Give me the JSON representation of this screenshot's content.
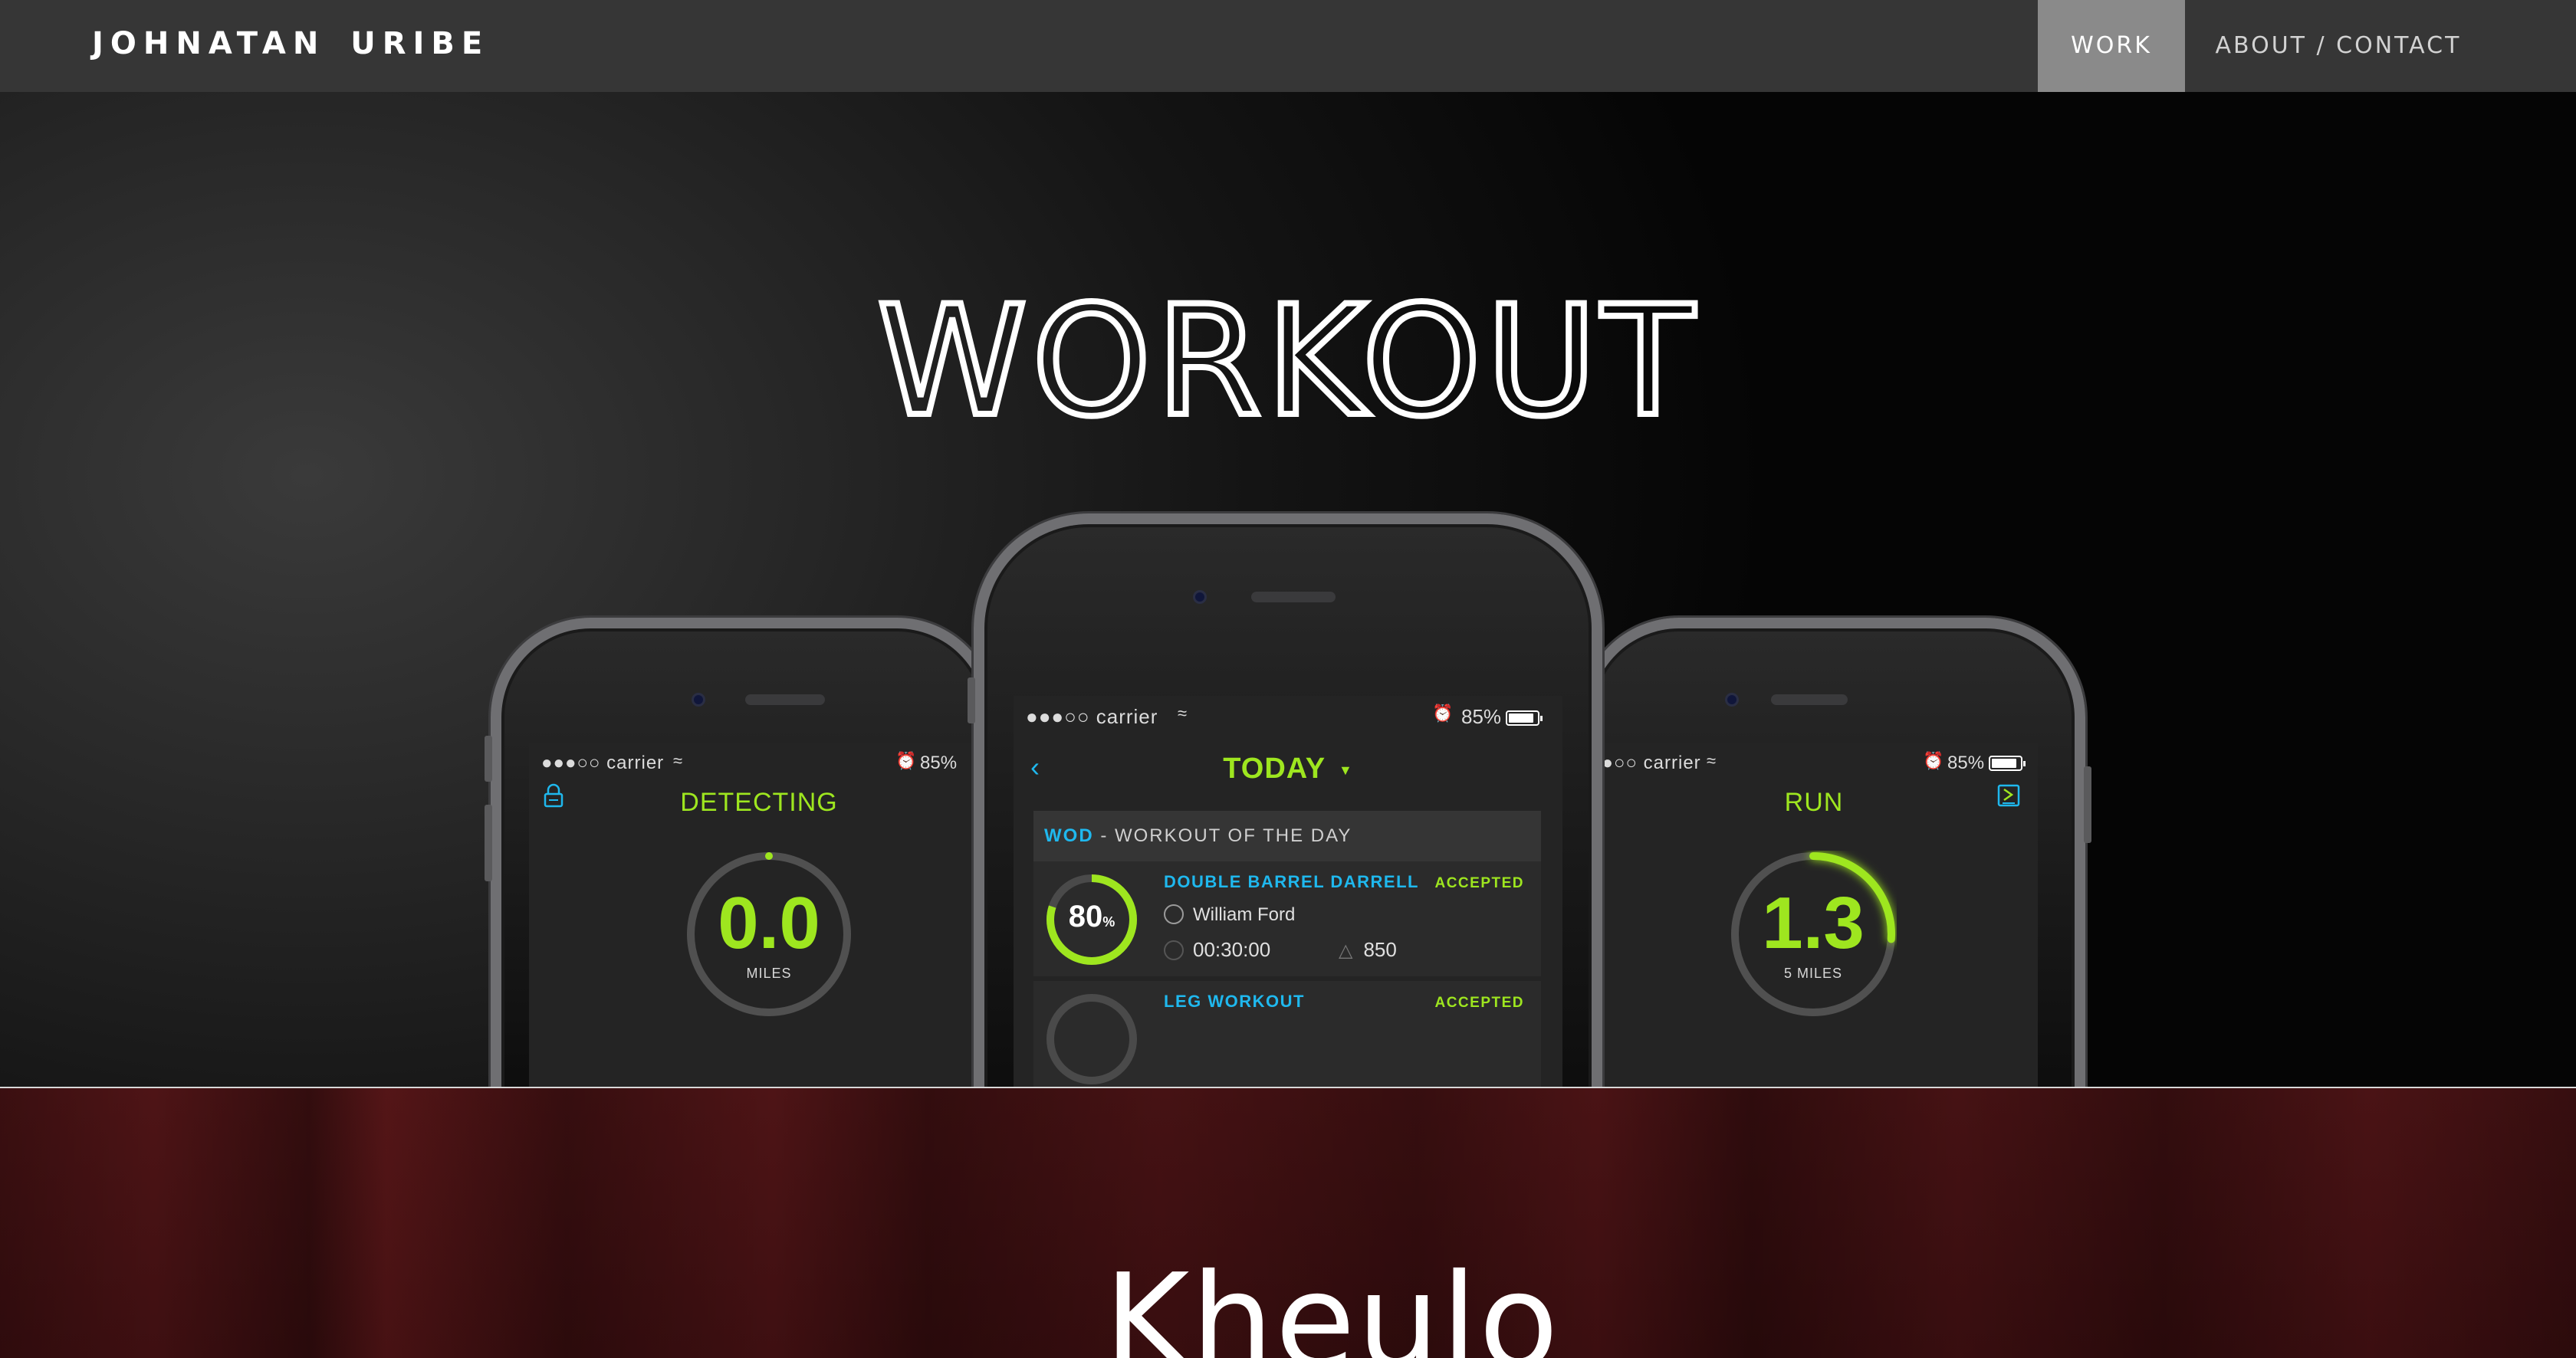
{
  "nav": {
    "brand": "JOHNATAN URIBE",
    "items": [
      {
        "label": "WORK",
        "active": true
      },
      {
        "label": "ABOUT / CONTACT",
        "active": false
      }
    ]
  },
  "hero": {
    "title": "WORKOUT",
    "phones": {
      "left": {
        "status_signal": "●●●○○ carrier",
        "status_battery": "85%",
        "title": "DETECTING",
        "ring_value": "0.0",
        "ring_unit": "MILES",
        "progress": 0
      },
      "center": {
        "status_signal": "●●●○○ carrier",
        "status_battery": "85%",
        "title": "TODAY",
        "wod_label": "WOD",
        "wod_rest": " - WORKOUT OF THE DAY",
        "items": [
          {
            "name": "DOUBLE BARREL DARRELL",
            "status": "ACCEPTED",
            "coach": "William Ford",
            "time": "00:30:00",
            "calories": "850",
            "percent": "80",
            "percent_unit": "%",
            "progress": 0.8
          },
          {
            "name": "LEG WORKOUT",
            "status": "ACCEPTED"
          }
        ]
      },
      "right": {
        "status_signal": "●●○○ carrier",
        "status_battery": "85%",
        "title": "RUN",
        "ring_value": "1.3",
        "ring_unit": "5 MILES",
        "progress": 0.26
      }
    }
  },
  "next_section": {
    "title": "Kheulo"
  },
  "colors": {
    "accent_green": "#9ee61f",
    "accent_blue": "#1fb8ee",
    "nav_bg": "#363636",
    "nav_active_bg": "#8a8a8a",
    "next_bg": "#4e1416"
  },
  "icons": {
    "wifi": "wifi-icon",
    "alarm": "alarm-icon",
    "battery": "battery-icon",
    "back": "chevron-left-icon",
    "dropdown": "triangle-down-icon",
    "lock": "lock-icon",
    "route": "route-icon",
    "coach": "person-icon",
    "clock": "clock-icon",
    "flame": "flame-icon"
  }
}
